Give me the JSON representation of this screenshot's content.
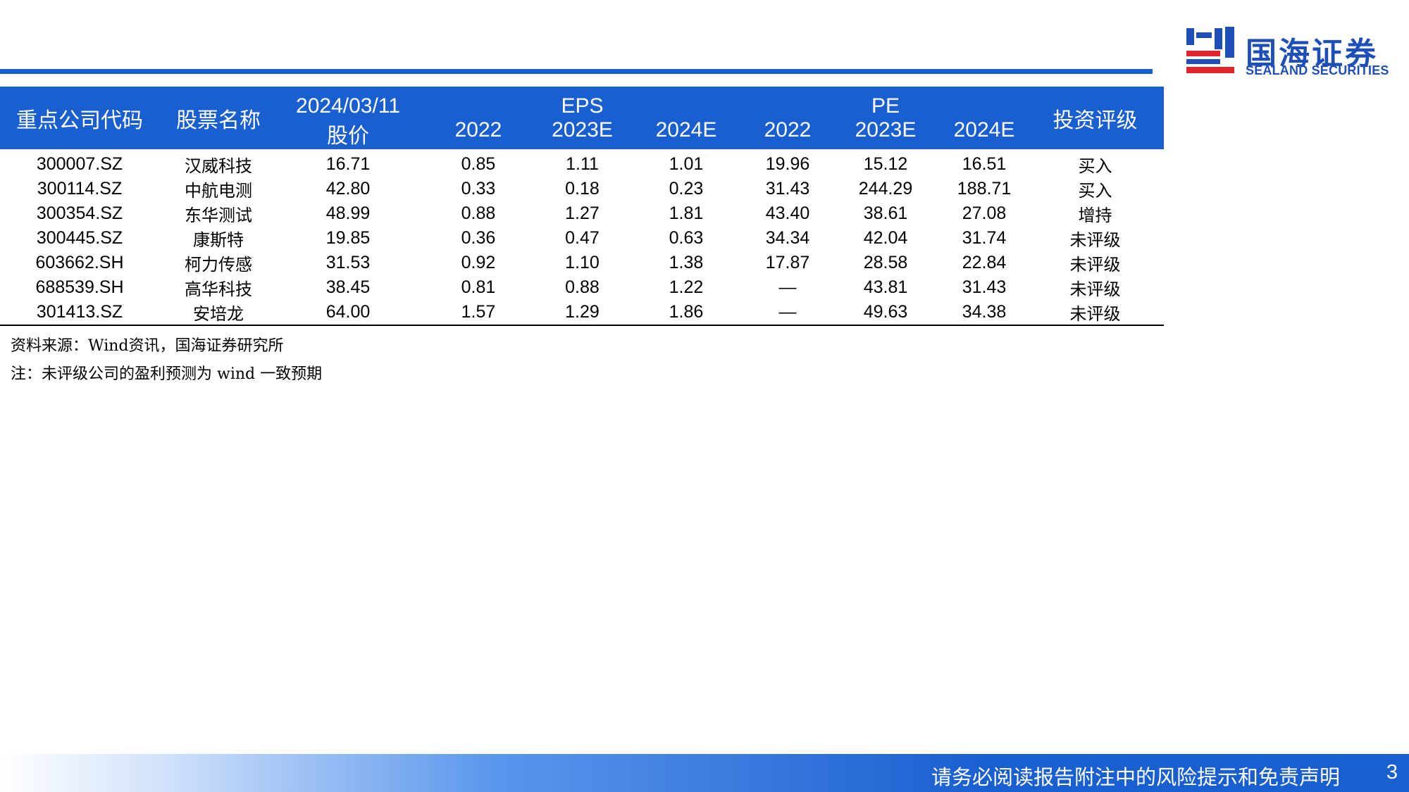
{
  "brand": {
    "name_cn": "国海证券",
    "name_en": "SEALAND SECURITIES"
  },
  "table": {
    "header": {
      "code": "重点公司代码",
      "name": "股票名称",
      "price_date": "2024/03/11",
      "price": "股价",
      "eps_group": "EPS",
      "pe_group": "PE",
      "years": [
        "2022",
        "2023E",
        "2024E"
      ],
      "rating": "投资评级"
    },
    "rows": [
      {
        "code": "300007.SZ",
        "name": "汉威科技",
        "price": "16.71",
        "eps": [
          "0.85",
          "1.11",
          "1.01"
        ],
        "pe": [
          "19.96",
          "15.12",
          "16.51"
        ],
        "rating": "买入"
      },
      {
        "code": "300114.SZ",
        "name": "中航电测",
        "price": "42.80",
        "eps": [
          "0.33",
          "0.18",
          "0.23"
        ],
        "pe": [
          "31.43",
          "244.29",
          "188.71"
        ],
        "rating": "买入"
      },
      {
        "code": "300354.SZ",
        "name": "东华测试",
        "price": "48.99",
        "eps": [
          "0.88",
          "1.27",
          "1.81"
        ],
        "pe": [
          "43.40",
          "38.61",
          "27.08"
        ],
        "rating": "增持"
      },
      {
        "code": "300445.SZ",
        "name": "康斯特",
        "price": "19.85",
        "eps": [
          "0.36",
          "0.47",
          "0.63"
        ],
        "pe": [
          "34.34",
          "42.04",
          "31.74"
        ],
        "rating": "未评级"
      },
      {
        "code": "603662.SH",
        "name": "柯力传感",
        "price": "31.53",
        "eps": [
          "0.92",
          "1.10",
          "1.38"
        ],
        "pe": [
          "17.87",
          "28.58",
          "22.84"
        ],
        "rating": "未评级"
      },
      {
        "code": "688539.SH",
        "name": "高华科技",
        "price": "38.45",
        "eps": [
          "0.81",
          "0.88",
          "1.22"
        ],
        "pe": [
          "—",
          "43.81",
          "31.43"
        ],
        "rating": "未评级"
      },
      {
        "code": "301413.SZ",
        "name": "安培龙",
        "price": "64.00",
        "eps": [
          "1.57",
          "1.29",
          "1.86"
        ],
        "pe": [
          "—",
          "49.63",
          "34.38"
        ],
        "rating": "未评级"
      }
    ]
  },
  "notes": {
    "source": "资料来源：Wind资讯，国海证券研究所",
    "note": "注：未评级公司的盈利预测为 wind 一致预期"
  },
  "footer": {
    "disclaimer": "请务必阅读报告附注中的风险提示和免责声明",
    "page": "3"
  },
  "colors": {
    "primary_blue": "#1a5fd0",
    "logo_red": "#e0252b"
  }
}
